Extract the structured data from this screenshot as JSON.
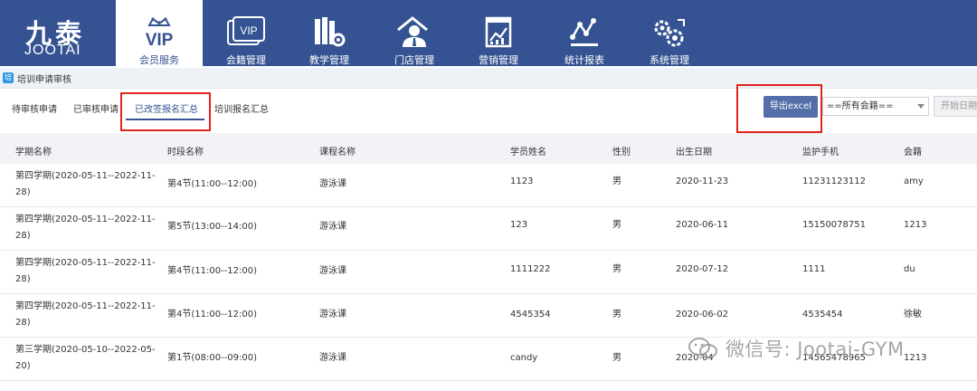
{
  "brand": {
    "name_cn": "九泰",
    "name_en": "JOOTAI"
  },
  "nav": [
    {
      "label": "会员服务",
      "icon": "vip-crown-icon"
    },
    {
      "label": "会籍管理",
      "icon": "vip-card-icon"
    },
    {
      "label": "教学管理",
      "icon": "books-gear-icon"
    },
    {
      "label": "门店管理",
      "icon": "store-manager-icon"
    },
    {
      "label": "营销管理",
      "icon": "marketing-chart-icon"
    },
    {
      "label": "统计报表",
      "icon": "statistics-icon"
    },
    {
      "label": "系统管理",
      "icon": "system-gear-icon"
    }
  ],
  "nav_vip_text": "VIP",
  "breadcrumb": {
    "icon_text": "培",
    "label": "培训申请审核"
  },
  "tabs": [
    {
      "label": "待审核申请"
    },
    {
      "label": "已审核申请"
    },
    {
      "label": "已改签报名汇总"
    },
    {
      "label": "培训报名汇总"
    }
  ],
  "toolbar": {
    "export_label": "导出excel",
    "membership_select": "==所有会籍==",
    "start_date_placeholder": "开始日期"
  },
  "table": {
    "columns": [
      "学期名称",
      "时段名称",
      "课程名称",
      "学员姓名",
      "性别",
      "出生日期",
      "监护手机",
      "会籍"
    ],
    "rows": [
      {
        "term": "第四学期(2020-05-11--2022-11-28)",
        "period": "第4节(11:00--12:00)",
        "course": "游泳课",
        "student": "1123",
        "gender": "男",
        "birth": "2020-11-23",
        "phone": "11231123112",
        "membership": "amy"
      },
      {
        "term": "第四学期(2020-05-11--2022-11-28)",
        "period": "第5节(13:00--14:00)",
        "course": "游泳课",
        "student": "123",
        "gender": "男",
        "birth": "2020-06-11",
        "phone": "15150078751",
        "membership": "1213"
      },
      {
        "term": "第四学期(2020-05-11--2022-11-28)",
        "period": "第4节(11:00--12:00)",
        "course": "游泳课",
        "student": "1111222",
        "gender": "男",
        "birth": "2020-07-12",
        "phone": "1111",
        "membership": "du"
      },
      {
        "term": "第四学期(2020-05-11--2022-11-28)",
        "period": "第4节(11:00--12:00)",
        "course": "游泳课",
        "student": "4545354",
        "gender": "男",
        "birth": "2020-06-02",
        "phone": "4535454",
        "membership": "徐敏"
      },
      {
        "term": "第三学期(2020-05-10--2022-05-20)",
        "period": "第1节(08:00--09:00)",
        "course": "游泳课",
        "student": "candy",
        "gender": "男",
        "birth": "2020-04",
        "phone": "14565478965",
        "membership": "1213"
      }
    ]
  },
  "watermark": {
    "text": "微信号: Jootai-GYM"
  },
  "colors": {
    "nav_bg": "#355392",
    "export_bg": "#536ea8",
    "highlight": "#e0231b"
  }
}
